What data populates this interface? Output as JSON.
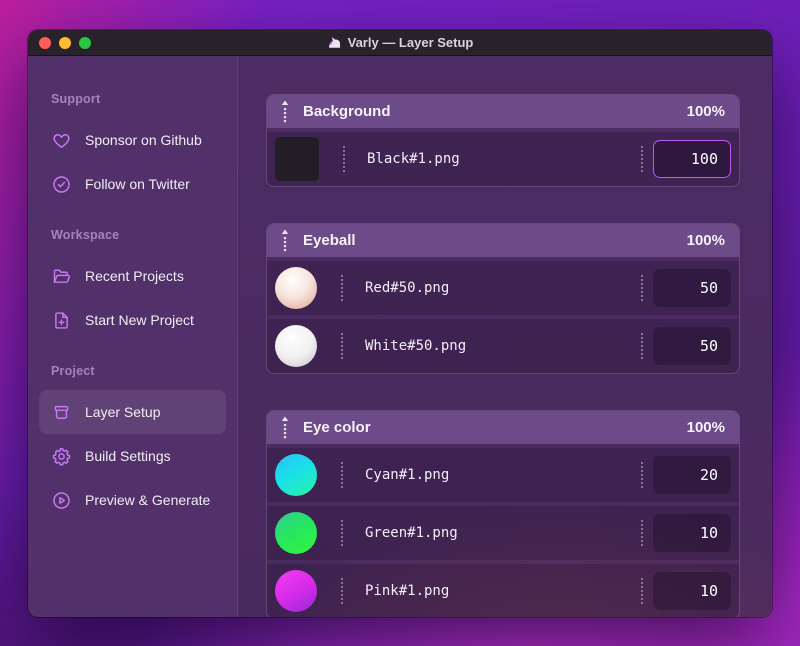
{
  "window": {
    "title": "Varly — Layer Setup",
    "traffic_lights": [
      {
        "name": "close",
        "color": "#ff5f57"
      },
      {
        "name": "minimize",
        "color": "#febc2e"
      },
      {
        "name": "zoom",
        "color": "#28c840"
      }
    ]
  },
  "sidebar": {
    "sections": [
      {
        "label": "Support",
        "items": [
          {
            "label": "Sponsor on Github",
            "icon": "heart",
            "active": false
          },
          {
            "label": "Follow on Twitter",
            "icon": "verified-check",
            "active": false
          }
        ]
      },
      {
        "label": "Workspace",
        "items": [
          {
            "label": "Recent Projects",
            "icon": "folder-open",
            "active": false
          },
          {
            "label": "Start New Project",
            "icon": "file-plus",
            "active": false
          }
        ]
      },
      {
        "label": "Project",
        "items": [
          {
            "label": "Layer Setup",
            "icon": "archive-box",
            "active": true
          },
          {
            "label": "Build Settings",
            "icon": "gear",
            "active": false
          },
          {
            "label": "Preview & Generate",
            "icon": "play-circle",
            "active": false
          }
        ]
      }
    ]
  },
  "main": {
    "groups": [
      {
        "name": "Background",
        "opacity": "100%",
        "items": [
          {
            "filename": "Black#1.png",
            "weight": "100",
            "thumb": "black-square",
            "focused": true
          }
        ]
      },
      {
        "name": "Eyeball",
        "opacity": "100%",
        "items": [
          {
            "filename": "Red#50.png",
            "weight": "50",
            "thumb": "red-sphere",
            "focused": false
          },
          {
            "filename": "White#50.png",
            "weight": "50",
            "thumb": "white-sphere",
            "focused": false
          }
        ]
      },
      {
        "name": "Eye color",
        "opacity": "100%",
        "items": [
          {
            "filename": "Cyan#1.png",
            "weight": "20",
            "thumb": "cyan-circle",
            "focused": false
          },
          {
            "filename": "Green#1.png",
            "weight": "10",
            "thumb": "green-circle",
            "focused": false
          },
          {
            "filename": "Pink#1.png",
            "weight": "10",
            "thumb": "pink-circle",
            "focused": false
          }
        ]
      }
    ]
  },
  "thumbnails": {
    "black-square": {
      "shape": "square",
      "css": "#231d26"
    },
    "red-sphere": {
      "shape": "circle",
      "css": "radial-gradient(circle at 42% 32%, #ffffff 0%, #f7e4dc 45%, #e8bcad 78%, #c9958a 100%)"
    },
    "white-sphere": {
      "shape": "circle",
      "css": "radial-gradient(circle at 42% 32%, #ffffff 0%, #f2f0f2 50%, #d8d4da 80%, #aea9b4 100%)"
    },
    "cyan-circle": {
      "shape": "circle",
      "css": "linear-gradient(150deg, #2bc2f2 5%, #19e0e8 45%, #2cf2a6 100%)"
    },
    "green-circle": {
      "shape": "circle",
      "css": "linear-gradient(150deg, #2ecf8f 5%, #27e85c 50%, #32f73e 100%)"
    },
    "pink-circle": {
      "shape": "circle",
      "css": "linear-gradient(150deg, #f23af2 5%, #d82ce8 50%, #9428d4 100%)"
    }
  },
  "colors": {
    "accent_icon": "#c678f0",
    "focus_border": "#bf5af2",
    "sidebar_bg": "#523069",
    "group_header_bg": "#6d4a88",
    "titlebar_bg": "#28222b"
  }
}
